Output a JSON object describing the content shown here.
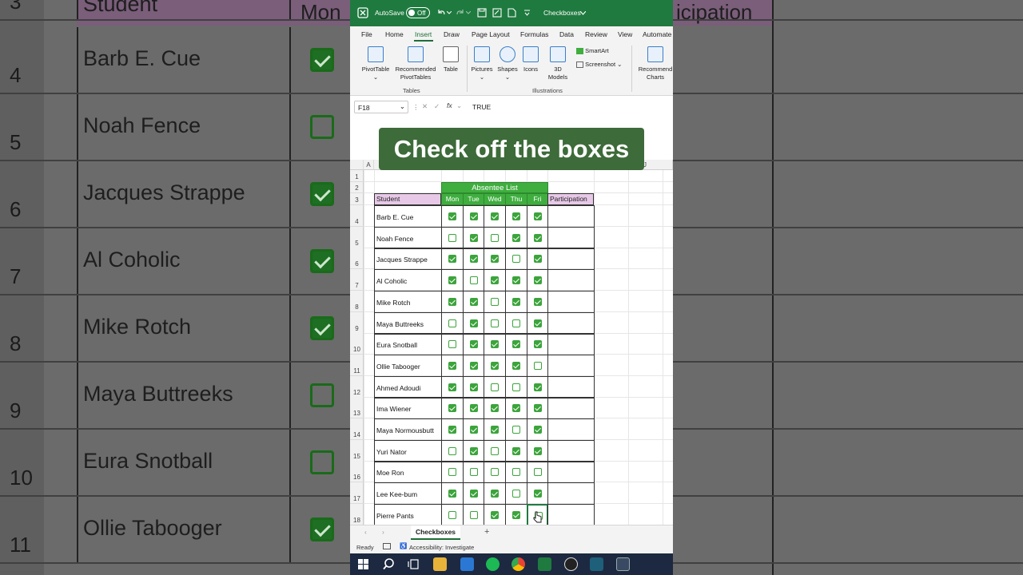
{
  "background": {
    "rows": [
      {
        "num": "3",
        "name": "Student",
        "checked": null
      },
      {
        "num": "4",
        "name": "Barb E. Cue",
        "checked": true
      },
      {
        "num": "5",
        "name": "Noah Fence",
        "checked": false
      },
      {
        "num": "6",
        "name": "Jacques Strappe",
        "checked": true
      },
      {
        "num": "7",
        "name": "Al Coholic",
        "checked": true
      },
      {
        "num": "8",
        "name": "Mike Rotch",
        "checked": true
      },
      {
        "num": "9",
        "name": "Maya Buttreeks",
        "checked": false
      },
      {
        "num": "10",
        "name": "Eura Snotball",
        "checked": false
      },
      {
        "num": "11",
        "name": "Ollie Tabooger",
        "checked": true
      }
    ],
    "header_mon": "Mon",
    "header_right": "icipation"
  },
  "titlebar": {
    "autosave_label": "AutoSave",
    "toggle_state": "Off",
    "filename": "Checkboxes"
  },
  "menu": {
    "items": [
      "File",
      "Home",
      "Insert",
      "Draw",
      "Page Layout",
      "Formulas",
      "Data",
      "Review",
      "View",
      "Automate"
    ],
    "active": "Insert"
  },
  "ribbon": {
    "pivottable": "PivotTable",
    "recommended_pivot_1": "Recommended",
    "recommended_pivot_2": "PivotTables",
    "table": "Table",
    "group_tables": "Tables",
    "pictures": "Pictures",
    "shapes": "Shapes",
    "icons": "Icons",
    "models_1": "3D",
    "models_2": "Models",
    "smartart": "SmartArt",
    "screenshot": "Screenshot",
    "group_illustrations": "Illustrations",
    "recommended_charts_1": "Recommend",
    "recommended_charts_2": "Charts"
  },
  "formula_bar": {
    "cell_ref": "F18",
    "fx": "fx",
    "value": "TRUE"
  },
  "overlay_caption": "Check off the boxes",
  "sheet": {
    "col_a": "A",
    "col_j": "J",
    "title": "Absentee List",
    "header_student": "Student",
    "days": [
      "Mon",
      "Tue",
      "Wed",
      "Thu",
      "Fri"
    ],
    "header_participation": "Participation",
    "row_numbers": [
      "1",
      "2",
      "3"
    ],
    "students": [
      {
        "row": "4",
        "name": "Barb E. Cue",
        "checks": [
          true,
          true,
          true,
          true,
          true
        ]
      },
      {
        "row": "5",
        "name": "Noah Fence",
        "checks": [
          false,
          true,
          false,
          true,
          true
        ]
      },
      {
        "row": "6",
        "name": "Jacques Strappe",
        "checks": [
          true,
          true,
          true,
          false,
          true
        ]
      },
      {
        "row": "7",
        "name": "Al Coholic",
        "checks": [
          true,
          false,
          true,
          true,
          true
        ]
      },
      {
        "row": "8",
        "name": "Mike Rotch",
        "checks": [
          true,
          true,
          false,
          true,
          true
        ]
      },
      {
        "row": "9",
        "name": "Maya Buttreeks",
        "checks": [
          false,
          true,
          false,
          false,
          true
        ]
      },
      {
        "row": "10",
        "name": "Eura Snotball",
        "checks": [
          false,
          true,
          true,
          true,
          true
        ]
      },
      {
        "row": "11",
        "name": "Ollie Tabooger",
        "checks": [
          true,
          true,
          true,
          true,
          false
        ]
      },
      {
        "row": "12",
        "name": "Ahmed Adoudi",
        "checks": [
          true,
          true,
          false,
          false,
          true
        ]
      },
      {
        "row": "13",
        "name": "Ima Wiener",
        "checks": [
          true,
          true,
          true,
          true,
          true
        ]
      },
      {
        "row": "14",
        "name": "Maya Normousbutt",
        "checks": [
          true,
          true,
          true,
          false,
          true
        ]
      },
      {
        "row": "15",
        "name": "Yuri Nator",
        "checks": [
          false,
          true,
          false,
          true,
          true
        ]
      },
      {
        "row": "16",
        "name": "Moe Ron",
        "checks": [
          false,
          false,
          false,
          false,
          false
        ]
      },
      {
        "row": "17",
        "name": "Lee Kee-bum",
        "checks": [
          true,
          true,
          true,
          false,
          true
        ]
      },
      {
        "row": "18",
        "name": "Pierre Pants",
        "checks": [
          false,
          false,
          true,
          true,
          false
        ]
      }
    ]
  },
  "tabs": {
    "sheet_name": "Checkboxes",
    "add": "+"
  },
  "status": {
    "ready": "Ready",
    "accessibility": "Accessibility: Investigate"
  },
  "colors": {
    "excel_green": "#1f7a3f",
    "checkbox_green": "#3ca43c",
    "header_pink": "#e7c9e7",
    "caption_bg": "#3d6b39"
  }
}
